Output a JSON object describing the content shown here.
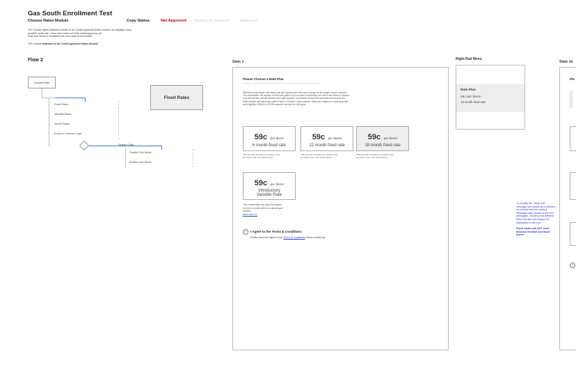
{
  "header": {
    "title": "Gas South Enrollment Test",
    "module": "Choose Rates Module",
    "copy_status_label": "Copy Status:",
    "status_not_approved": "Not Approved",
    "status_waiting": "Waiting for Approval",
    "status_approved": "Approved",
    "intro_lines": [
      "The Choose Rates Module is similar to the Credit-Approved Rates module, but displays every",
      "possible credit rate, since users have not been credit-approved yet.",
      "Note that Terms & Conditions are not a part of this module."
    ],
    "dependency_prefix": "This module ",
    "dependency_bold": "depends on the Credit-Approved Rates Module"
  },
  "flow": {
    "title": "Flow 2",
    "choose_rate": "Choose Rate",
    "fixed_rates_box": "Fixed Rates",
    "options": [
      "Fixed Rates",
      "Variable Rates",
      "Senior Rates",
      "Promo or Partner Code"
    ],
    "realtor_code": "Realtor Code",
    "realtor_fields": [
      "Realtor First Name",
      "Realtor Last Name"
    ]
  },
  "state1": {
    "title": "State 1",
    "heading": "Please Choose a Rate Plan",
    "paragraph": [
      "With fixed natural gas rate plans, you get a great price that won't charge for the length of your contract.",
      "The cancellation fee applies to fixed rate plans if you choose to terminate your fixed rate before it expires.",
      "Your bill will also include Atlanta Gas Light charges, a customer service fee and state and local taxes.",
      "Rates shown will reflect any valid Promo or Partner Codes entered. Rates are subject to credit approval",
      "and eligibility.  A $5.95 or $9.95 customer service fee will apply."
    ],
    "plans": [
      {
        "price": "59c",
        "unit": "per therm",
        "term": "6 month fixed rate",
        "desc": [
          "This rate plan provides a consistent rate",
          "per therm over a 6 month period"
        ]
      },
      {
        "price": "59c",
        "unit": "per therm",
        "term": "12 month fixed rate",
        "desc": [
          "This rate plan provides a consistent rate",
          "per therm over a 12 month period"
        ]
      },
      {
        "price": "59c",
        "unit": "per therm",
        "term": "18 month fixed rate",
        "desc": [
          "This rate plan provides a consistent rate",
          "per therm over a 18 month period"
        ]
      }
    ],
    "variable_plan": {
      "price": "59c",
      "unit": "per therm",
      "term_line1": "Introductory",
      "term_line2": "Variable Rate",
      "desc": [
        "This residential rate plan fluctuates",
        "month to month with the natural gas",
        "market."
      ],
      "more_info": "More Info (?)"
    },
    "agree_label": "I Agree to the Terms & Conditions",
    "agree_sub_prefix": "Please read and agree to the ",
    "agree_sub_link": "Terms & Conditions",
    "agree_sub_suffix": " before continuing"
  },
  "right_rail": {
    "title": "Right Rail Menu",
    "rate_plan_label": "Rate Plan",
    "rate_value": "59c per therm",
    "rate_term": "18 month fixed rate"
  },
  "note": {
    "lines": [
      "To simplify the \"More Info\"",
      "message and speed up production,",
      "we should look into using a",
      "message state similar to the error",
      "messages. Clicking on a different",
      "More Info link will replace the",
      "information in the box."
    ],
    "bold_lines": [
      "Hover states will NOT work",
      "because of tablet and touch",
      "users!"
    ]
  },
  "state1b": {
    "title": "State 1b",
    "heading_fragment": "Ple"
  }
}
